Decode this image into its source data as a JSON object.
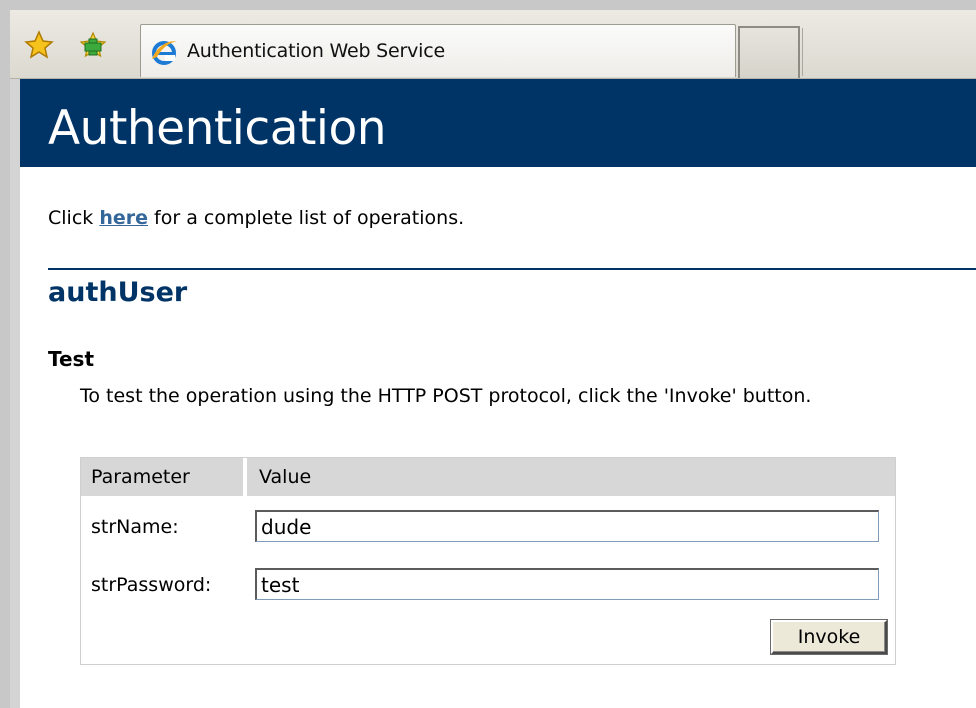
{
  "browser": {
    "tab_title": "Authentication Web Service",
    "icons": [
      "favorites-star-icon",
      "add-favorite-icon",
      "ie-page-icon"
    ]
  },
  "page": {
    "banner_title": "Authentication",
    "intro_prefix": "Click ",
    "intro_link": "here",
    "intro_suffix": " for a complete list of operations.",
    "operation_title": "authUser",
    "test_heading": "Test",
    "test_description": "To test the operation using the HTTP POST protocol, click the 'Invoke' button.",
    "form": {
      "col_parameter": "Parameter",
      "col_value": "Value",
      "rows": [
        {
          "label": "strName:",
          "value": "dude"
        },
        {
          "label": "strPassword:",
          "value": "test"
        }
      ],
      "invoke_label": "Invoke"
    },
    "colors": {
      "banner": "#003366",
      "link": "#336699",
      "heading": "#003366"
    }
  }
}
